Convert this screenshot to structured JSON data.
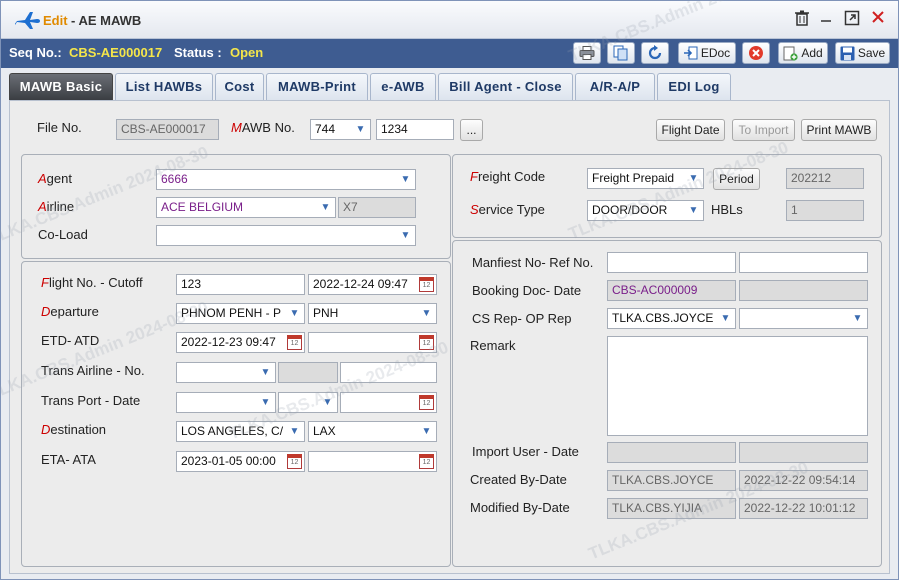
{
  "window": {
    "title_edit": "Edit",
    "title_rest": "- AE MAWB",
    "icons": [
      "trash-icon",
      "minimize-icon",
      "restore-icon",
      "close-icon"
    ]
  },
  "infobar": {
    "seq_label": "Seq No.:",
    "seq_value": "CBS-AE000017",
    "status_label": "Status :",
    "status_value": "Open",
    "buttons": {
      "edoc": "EDoc",
      "add": "Add",
      "save": "Save"
    }
  },
  "tabs": [
    "MAWB Basic",
    "List HAWBs",
    "Cost",
    "MAWB-Print",
    "e-AWB",
    "Bill Agent - Close",
    "A/R-A/P",
    "EDI Log"
  ],
  "top": {
    "file_no_label": "File No.",
    "file_no": "CBS-AE000017",
    "mawb_label_first": "M",
    "mawb_label_rest": "AWB No.",
    "mawb_prefix": "744",
    "mawb_no": "1234",
    "ellipsis": "...",
    "flight_date_btn": "Flight Date",
    "to_import_btn": "To Import",
    "print_mawb_btn": "Print MAWB"
  },
  "agent_panel": {
    "agent_first": "A",
    "agent_rest": "gent",
    "agent_value": "6666",
    "airline_first": "A",
    "airline_rest": "irline",
    "airline_value": "ACE BELGIUM",
    "airline_code": "X7",
    "coload_label": "Co-Load",
    "coload_value": ""
  },
  "flight_panel": {
    "flight_first": "F",
    "flight_rest": "light No. -  Cutoff",
    "flight_no": "123",
    "cutoff": "2022-12-24 09:47",
    "departure_first": "D",
    "departure_rest": "eparture",
    "departure_value": "PHNOM PENH - P",
    "departure_code": "PNH",
    "etd_label": "ETD- ATD",
    "etd": "2022-12-23 09:47",
    "atd": "",
    "trans_airline_label": "Trans Airline -  No.",
    "trans_port_label": "Trans Port -  Date",
    "destination_first": "D",
    "destination_rest": "estination",
    "destination_value": "LOS ANGELES, C/",
    "destination_code": "LAX",
    "eta_label": "ETA- ATA",
    "eta": "2023-01-05 00:00",
    "ata": ""
  },
  "freight_panel": {
    "freight_first": "F",
    "freight_rest": "reight Code",
    "freight_value": "Freight Prepaid",
    "period_btn": "Period",
    "period_value": "202212",
    "service_first": "S",
    "service_rest": "ervice Type",
    "service_value": "DOOR/DOOR",
    "hbls_label": "HBLs",
    "hbls_value": "1"
  },
  "ref_panel": {
    "manifest_label": "Manfiest No- Ref No.",
    "booking_label": "Booking Doc- Date",
    "booking_value": "CBS-AC000009",
    "csrep_label": "CS Rep- OP Rep",
    "csrep_value": "TLKA.CBS.JOYCE",
    "remark_label": "Remark",
    "import_label": "Import User -  Date",
    "created_label": "Created By-Date",
    "created_by": "TLKA.CBS.JOYCE",
    "created_date": "2022-12-22 09:54:14",
    "modified_label": "Modified By-Date",
    "modified_by": "TLKA.CBS.YIJIA",
    "modified_date": "2022-12-22 10:01:12"
  },
  "watermark": "TLKA.CBS.Admin 2024-08-30",
  "colors": {
    "infobar": "#3e5c91",
    "status": "#f5e64a",
    "required": "#cc0000",
    "edit_title": "#e08a00"
  }
}
